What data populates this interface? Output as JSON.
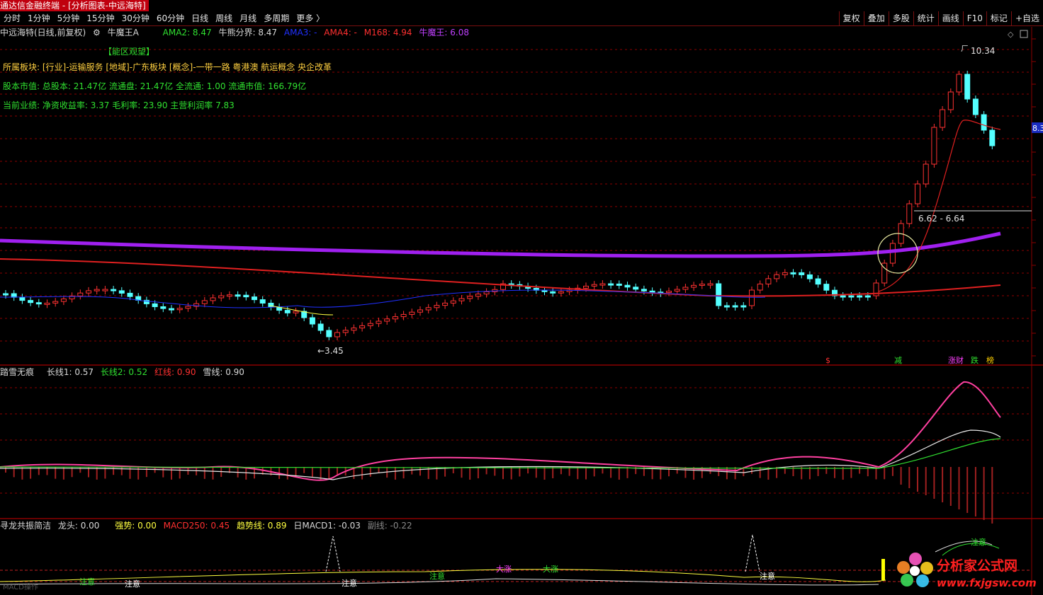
{
  "window": {
    "title": "通达信金融终端 - [分析图表-中远海特]"
  },
  "toolbar": {
    "periods": [
      "分时",
      "1分钟",
      "5分钟",
      "15分钟",
      "30分钟",
      "60分钟",
      "日线",
      "周线",
      "月线",
      "多周期",
      "更多 〉"
    ],
    "actions": [
      "复权",
      "叠加",
      "多股",
      "统计",
      "画线",
      "F10",
      "标记",
      "+自选"
    ]
  },
  "main_header": {
    "stock": "中远海特(日线,前复权)",
    "indicator": "牛魔王A",
    "ama2": "AMA2: 8.47",
    "bull_bear": "牛熊分界: 8.47",
    "ama3": "AMA3: -",
    "ama4": "AMA4: -",
    "m168": "M168: 4.94",
    "bull_king": "牛魔王: 6.08"
  },
  "info": {
    "zone": "【能区观望】",
    "sector": "所属板块: [行业]-运输服务 [地域]-广东板块 [概念]-一带一路 粤港澳 航运概念 央企改革",
    "equity": "股本市值: 总股本: 21.47亿 流通盘: 21.47亿 全流通: 1.00 流通市值: 166.79亿",
    "performance": "当前业绩: 净资收益率: 3.37 毛利率: 23.90 主营利润率 7.83"
  },
  "price_labels": {
    "high": "10.34",
    "low": "3.45",
    "range": "6.62 - 6.64",
    "current": "8.3"
  },
  "events": [
    {
      "text": "$",
      "color": "#ff3030"
    },
    {
      "text": "减",
      "color": "#30e030"
    },
    {
      "text": "涨财",
      "color": "#ff40ff"
    },
    {
      "text": "跌",
      "color": "#30e030"
    },
    {
      "text": "榜",
      "color": "#ffd000"
    }
  ],
  "panel2": {
    "name": "踏雪无痕",
    "line1": "长线1: 0.57",
    "line2": "长线2: 0.52",
    "red": "红线: 0.90",
    "snow": "雪线: 0.90"
  },
  "panel3": {
    "name": "寻龙共振简洁",
    "head": "龙头: 0.00",
    "strong": "强势: 0.00",
    "macd250": "MACD250: 0.45",
    "trend": "趋势线: 0.89",
    "dmacd": "日MACD1: -0.03",
    "sub": "副线: -0.22",
    "tags": [
      "注意",
      "注意",
      "注意",
      "大涨",
      "大涨",
      "注意",
      "注意",
      "注意"
    ],
    "faint": "MACD操作"
  },
  "watermark": {
    "name": "分析家公式网",
    "url": "www.fxjgsw.com"
  },
  "colors": {
    "up": "#ff3232",
    "down": "#54ffff",
    "purple": "#a020f0",
    "red_line": "#e02020",
    "yellow": "#ffff40",
    "grid": "#8b0000"
  }
}
